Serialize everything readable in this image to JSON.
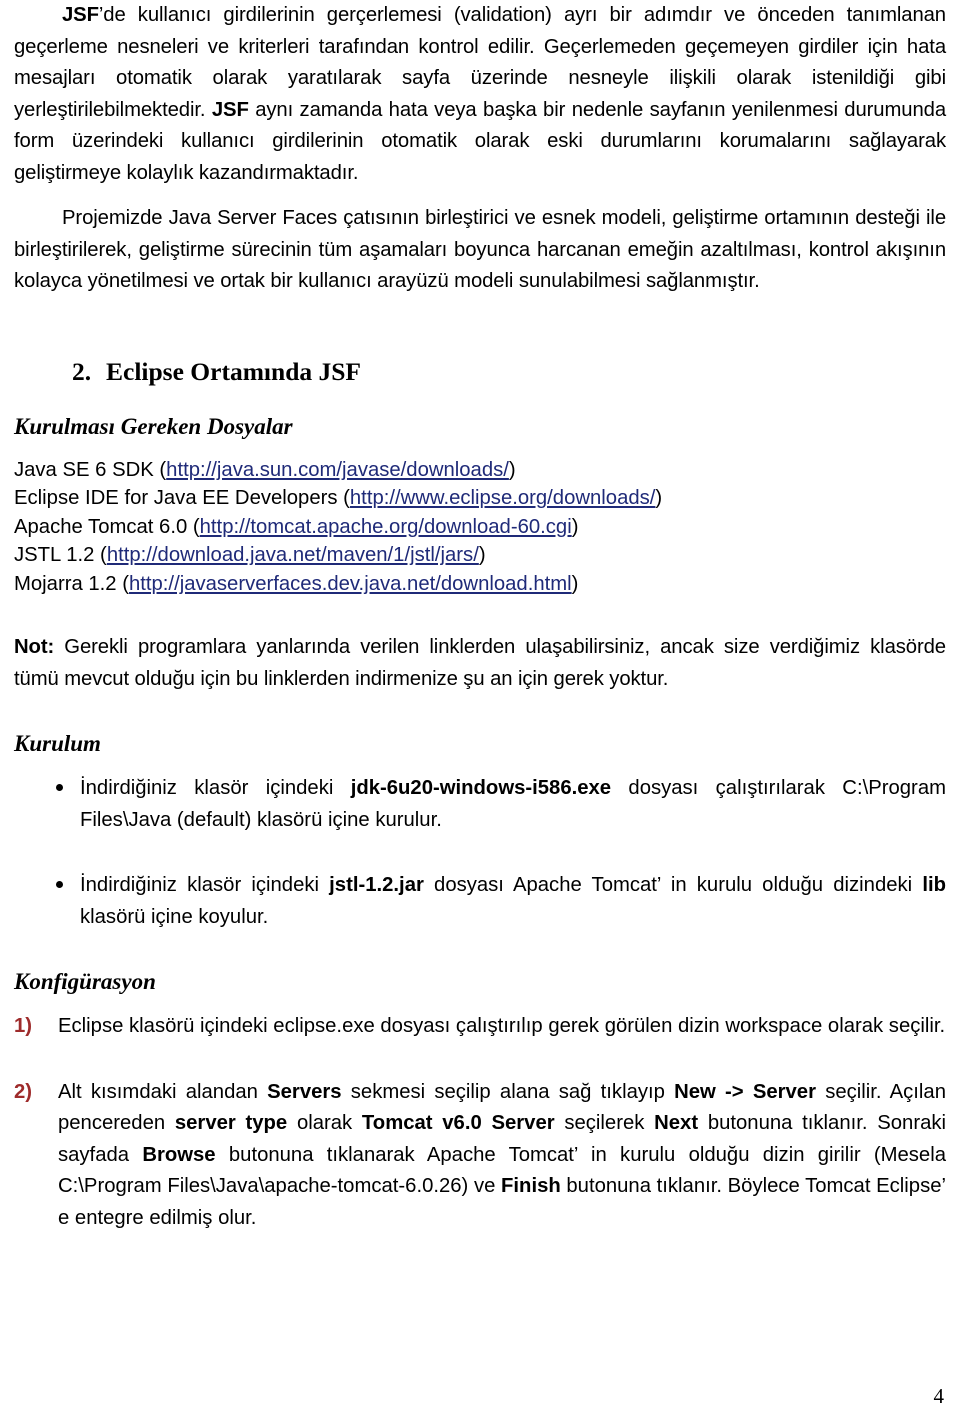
{
  "document": {
    "page_number": "4",
    "link_color": "#1F2A78",
    "list_number_color": "#9E2B2B"
  },
  "intro": {
    "p1": {
      "lead_bold": "JSF",
      "text": "’de kullanıcı girdilerinin gerçerlemesi (validation) ayrı bir adımdır ve önceden tanımlanan geçerleme nesneleri ve kriterleri tarafından kontrol edilir. Geçerlemeden geçemeyen girdiler için hata mesajları otomatik olarak yaratılarak sayfa üzerinde nesneyle ilişkili olarak istenildiği gibi yerleştirilebilmektedir. ",
      "mid_bold": "JSF",
      "text2": " aynı zamanda hata veya başka bir nedenle sayfanın yenilenmesi durumunda form üzerindeki kullanıcı girdilerinin otomatik olarak eski durumlarını korumalarını sağlayarak geliştirmeye kolaylık kazandırmaktadır."
    },
    "p2": "Projemizde Java Server Faces çatısının birleştirici ve esnek modeli, geliştirme ortamının desteği ile birleştirilerek, geliştirme sürecinin tüm aşamaları boyunca harcanan emeğin azaltılması, kontrol akışının kolayca yönetilmesi ve ortak bir kullanıcı arayüzü modeli sunulabilmesi sağlanmıştır."
  },
  "section2": {
    "number": "2.",
    "title": "Eclipse Ortamında JSF",
    "files_heading": "Kurulması Gereken Dosyalar",
    "files": [
      {
        "name": "Java SE 6 SDK (",
        "url": "http://java.sun.com/javase/downloads/",
        "close": ")"
      },
      {
        "name": "Eclipse IDE for Java EE Developers (",
        "url": "http://www.eclipse.org/downloads/",
        "close": ")"
      },
      {
        "name": "Apache Tomcat 6.0 (",
        "url": "http://tomcat.apache.org/download-60.cgi",
        "close": ")"
      },
      {
        "name": "JSTL 1.2 (",
        "url": "http://download.java.net/maven/1/jstl/jars/",
        "close": ")"
      },
      {
        "name": "Mojarra 1.2 (",
        "url": "http://javaserverfaces.dev.java.net/download.html",
        "close": ")"
      }
    ],
    "note": {
      "label": "Not:",
      "text": " Gerekli programlara yanlarında verilen linklerden ulaşabilirsiniz, ancak size verdiğimiz klasörde tümü mevcut olduğu için bu linklerden indirmenize şu an için gerek yoktur."
    },
    "install_heading": "Kurulum",
    "install_items": [
      {
        "pre": "İndirdiğiniz klasör içindeki ",
        "bold": "jdk-6u20-windows-i586.exe",
        "post": " dosyası çalıştırılarak C:\\Program Files\\Java (default) klasörü içine kurulur."
      },
      {
        "pre": "İndirdiğiniz klasör içindeki ",
        "bold": "jstl-1.2.jar",
        "mid": " dosyası Apache Tomcat’ in kurulu olduğu dizindeki ",
        "bold2": "lib",
        "post": " klasörü içine koyulur."
      }
    ],
    "config_heading": "Konfigürasyon",
    "config_items": [
      {
        "marker": "1)",
        "text": "Eclipse klasörü içindeki eclipse.exe dosyası çalıştırılıp gerek görülen dizin workspace olarak seçilir."
      },
      {
        "marker": "2)",
        "t1": "Alt kısımdaki alandan ",
        "b1": "Servers",
        "t2": " sekmesi seçilip alana sağ tıklayıp ",
        "b2": "New -> Server",
        "t3": " seçilir. Açılan pencereden ",
        "b3": "server type",
        "t4": " olarak ",
        "b4": "Tomcat v6.0 Server",
        "t5": " seçilerek ",
        "b5": "Next",
        "t6": " butonuna tıklanır. Sonraki sayfada ",
        "b6": "Browse",
        "t7": " butonuna tıklanarak Apache Tomcat’ in kurulu olduğu dizin girilir (Mesela C:\\Program Files\\Java\\apache-tomcat-6.0.26) ve ",
        "b7": "Finish",
        "t8": " butonuna tıklanır. Böylece Tomcat Eclipse’ e entegre edilmiş olur."
      }
    ]
  }
}
